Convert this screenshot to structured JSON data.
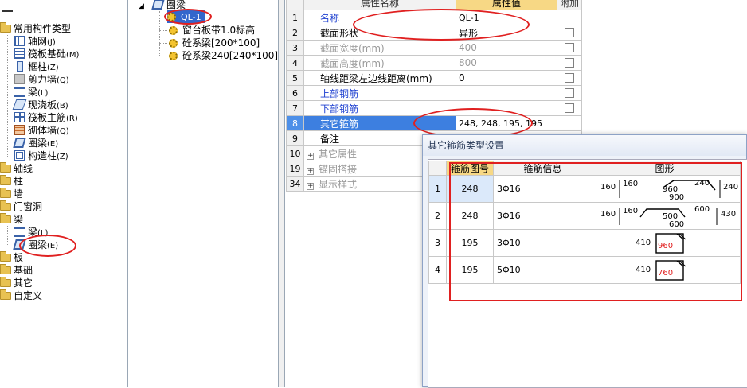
{
  "left_tree": {
    "root_items": [
      {
        "label": "常用构件类型"
      },
      {
        "label": "轴线"
      },
      {
        "label": "柱"
      },
      {
        "label": "墙"
      },
      {
        "label": "门窗洞"
      },
      {
        "label": "梁"
      },
      {
        "label": "板"
      },
      {
        "label": "基础"
      },
      {
        "label": "其它"
      },
      {
        "label": "自定义"
      }
    ],
    "common_children": [
      {
        "label": "轴网",
        "key": "(J)"
      },
      {
        "label": "筏板基础",
        "key": "(M)"
      },
      {
        "label": "框柱",
        "key": "(Z)"
      },
      {
        "label": "剪力墙",
        "key": "(Q)"
      },
      {
        "label": "梁",
        "key": "(L)"
      },
      {
        "label": "现浇板",
        "key": "(B)"
      },
      {
        "label": "筏板主筋",
        "key": "(R)"
      },
      {
        "label": "砌体墙",
        "key": "(Q)"
      },
      {
        "label": "圈梁",
        "key": "(E)"
      },
      {
        "label": "构造柱",
        "key": "(Z)"
      }
    ],
    "beam_children": [
      {
        "label": "梁",
        "key": "(L)"
      },
      {
        "label": "圈梁",
        "key": "(E)"
      }
    ]
  },
  "mid_tree": {
    "root": "圈梁",
    "items": [
      "QL-1",
      "窗台板带1.0标高",
      "砼系梁[200*100]",
      "砼系梁240[240*100]"
    ]
  },
  "property_grid": {
    "headers": {
      "name": "属性名称",
      "value": "属性值",
      "add": "附加"
    },
    "rows": [
      {
        "num": "1",
        "name": "名称",
        "value": "QL-1",
        "style": "blue",
        "check": false
      },
      {
        "num": "2",
        "name": "截面形状",
        "value": "异形",
        "style": "normal",
        "check": true
      },
      {
        "num": "3",
        "name": "截面宽度(mm)",
        "value": "400",
        "style": "gray",
        "check": true
      },
      {
        "num": "4",
        "name": "截面高度(mm)",
        "value": "800",
        "style": "gray",
        "check": true
      },
      {
        "num": "5",
        "name": "轴线距梁左边线距离(mm)",
        "value": "0",
        "style": "normal",
        "check": true
      },
      {
        "num": "6",
        "name": "上部钢筋",
        "value": "",
        "style": "blue",
        "check": true
      },
      {
        "num": "7",
        "name": "下部钢筋",
        "value": "",
        "style": "blue",
        "check": true
      },
      {
        "num": "8",
        "name": "其它箍筋",
        "value": "248, 248, 195, 195",
        "style": "selected",
        "check": false
      },
      {
        "num": "9",
        "name": "备注",
        "value": "",
        "style": "normal",
        "check": false
      },
      {
        "num": "10",
        "name": "其它属性",
        "value": "",
        "style": "group",
        "check": false
      },
      {
        "num": "19",
        "name": "锚固搭接",
        "value": "",
        "style": "group",
        "check": false
      },
      {
        "num": "34",
        "name": "显示样式",
        "value": "",
        "style": "group",
        "check": false
      }
    ]
  },
  "dialog": {
    "title": "其它箍筋类型设置",
    "headers": [
      "箍筋图号",
      "箍筋信息",
      "图形"
    ],
    "rows": [
      {
        "num": "1",
        "code": "248",
        "info": "3Φ16",
        "figure": [
          "160",
          "160",
          "960",
          "900",
          "240",
          "240"
        ]
      },
      {
        "num": "2",
        "code": "248",
        "info": "3Φ16",
        "figure": [
          "160",
          "160",
          "500",
          "600",
          "600",
          "430"
        ]
      },
      {
        "num": "3",
        "code": "195",
        "info": "3Φ10",
        "figure": [
          "410",
          "960"
        ]
      },
      {
        "num": "4",
        "code": "195",
        "info": "5Φ10",
        "figure": [
          "410",
          "760"
        ]
      }
    ]
  },
  "colors": {
    "accent_red": "#e02020",
    "selection_blue": "#3d7fe0",
    "header_yellow": "#f7d885"
  }
}
